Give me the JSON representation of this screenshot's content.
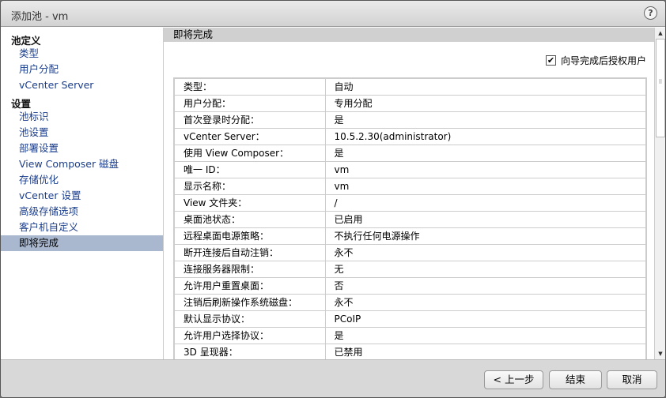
{
  "window": {
    "title": "添加池 - vm",
    "help": "?"
  },
  "sidebar": {
    "sections": [
      {
        "label": "池定义"
      },
      {
        "label": "设置"
      }
    ],
    "items": [
      {
        "label": "类型"
      },
      {
        "label": "用户分配"
      },
      {
        "label": "vCenter Server"
      },
      {
        "label": "池标识"
      },
      {
        "label": "池设置"
      },
      {
        "label": "部署设置"
      },
      {
        "label": "View Composer 磁盘"
      },
      {
        "label": "存储优化"
      },
      {
        "label": "vCenter 设置"
      },
      {
        "label": "高级存储选项"
      },
      {
        "label": "客户机自定义"
      },
      {
        "label": "即将完成",
        "selected": true
      }
    ]
  },
  "main": {
    "header": "即将完成",
    "entitle_checkbox": {
      "label": "向导完成后授权用户",
      "checked": true
    },
    "rows": [
      {
        "k": "类型：",
        "v": "自动"
      },
      {
        "k": "用户分配：",
        "v": "专用分配"
      },
      {
        "k": "首次登录时分配：",
        "v": "是"
      },
      {
        "k": "vCenter Server：",
        "v": "10.5.2.30(administrator)"
      },
      {
        "k": "使用 View Composer：",
        "v": "是"
      },
      {
        "k": "唯一 ID：",
        "v": "vm"
      },
      {
        "k": "显示名称：",
        "v": "vm"
      },
      {
        "k": "View 文件夹：",
        "v": "/"
      },
      {
        "k": "桌面池状态：",
        "v": "已启用"
      },
      {
        "k": "远程桌面电源策略：",
        "v": "不执行任何电源操作"
      },
      {
        "k": "断开连接后自动注销：",
        "v": "永不"
      },
      {
        "k": "连接服务器限制：",
        "v": "无"
      },
      {
        "k": "允许用户重置桌面：",
        "v": "否"
      },
      {
        "k": "注销后刷新操作系统磁盘：",
        "v": "永不"
      },
      {
        "k": "默认显示协议：",
        "v": "PCoIP"
      },
      {
        "k": "允许用户选择协议：",
        "v": "是"
      },
      {
        "k": "3D 呈现器：",
        "v": "已禁用"
      }
    ]
  },
  "footer": {
    "back": "< 上一步",
    "finish": "结束",
    "cancel": "取消"
  }
}
